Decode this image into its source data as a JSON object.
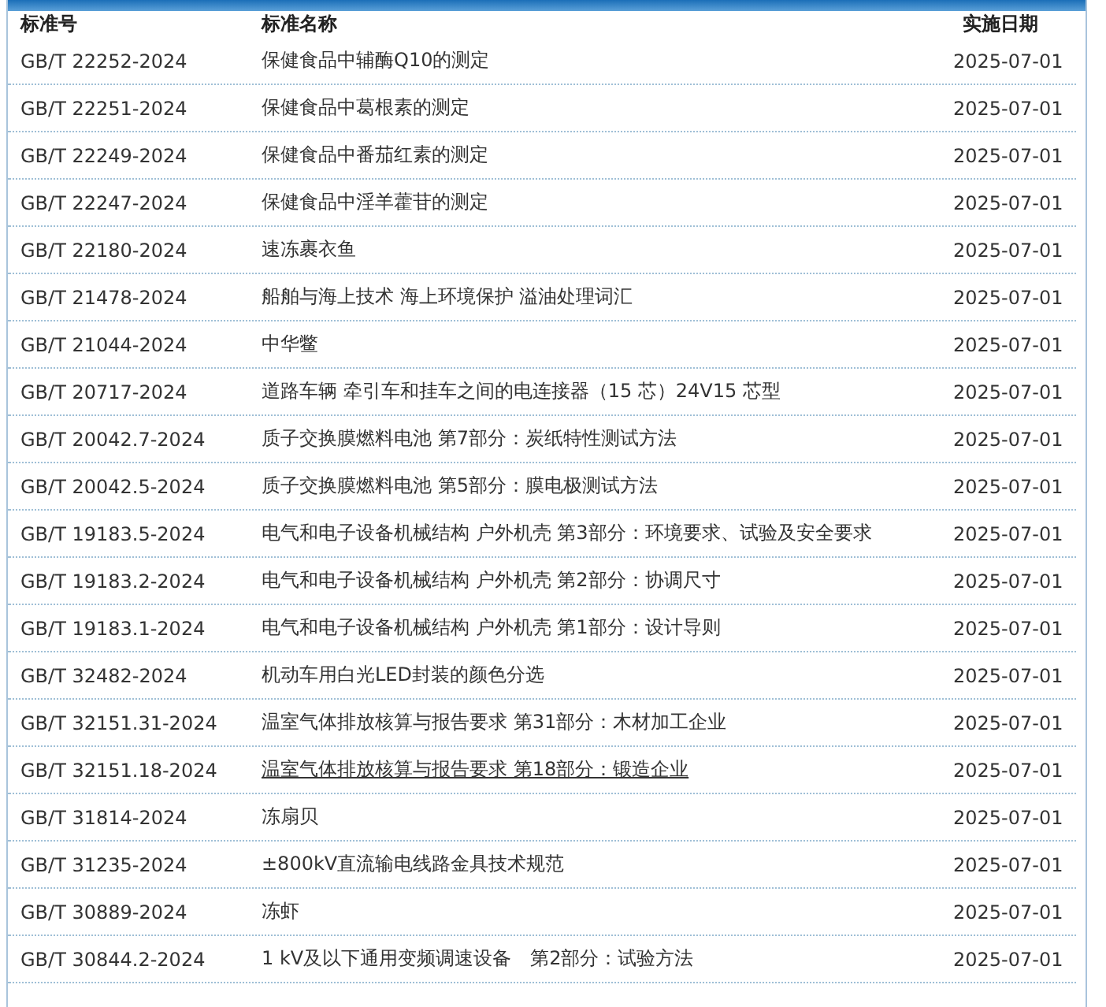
{
  "table": {
    "columns": [
      "标准号",
      "标准名称",
      "实施日期"
    ],
    "rows": [
      {
        "code": "GB/T 22252-2024",
        "name": "保健食品中辅酶Q10的测定",
        "date": "2025-07-01",
        "hovered": false
      },
      {
        "code": "GB/T 22251-2024",
        "name": "保健食品中葛根素的测定",
        "date": "2025-07-01",
        "hovered": false
      },
      {
        "code": "GB/T 22249-2024",
        "name": "保健食品中番茄红素的测定",
        "date": "2025-07-01",
        "hovered": false
      },
      {
        "code": "GB/T 22247-2024",
        "name": "保健食品中淫羊藿苷的测定",
        "date": "2025-07-01",
        "hovered": false
      },
      {
        "code": "GB/T 22180-2024",
        "name": "速冻裹衣鱼",
        "date": "2025-07-01",
        "hovered": false
      },
      {
        "code": "GB/T 21478-2024",
        "name": "船舶与海上技术 海上环境保护 溢油处理词汇",
        "date": "2025-07-01",
        "hovered": false
      },
      {
        "code": "GB/T 21044-2024",
        "name": "中华鳖",
        "date": "2025-07-01",
        "hovered": false
      },
      {
        "code": "GB/T 20717-2024",
        "name": "道路车辆 牵引车和挂车之间的电连接器（15 芯）24V15 芯型",
        "date": "2025-07-01",
        "hovered": false
      },
      {
        "code": "GB/T 20042.7-2024",
        "name": "质子交换膜燃料电池 第7部分：炭纸特性测试方法",
        "date": "2025-07-01",
        "hovered": false
      },
      {
        "code": "GB/T 20042.5-2024",
        "name": "质子交换膜燃料电池 第5部分：膜电极测试方法",
        "date": "2025-07-01",
        "hovered": false
      },
      {
        "code": "GB/T 19183.5-2024",
        "name": "电气和电子设备机械结构 户外机壳 第3部分：环境要求、试验及安全要求",
        "date": "2025-07-01",
        "hovered": false
      },
      {
        "code": "GB/T 19183.2-2024",
        "name": "电气和电子设备机械结构 户外机壳 第2部分：协调尺寸",
        "date": "2025-07-01",
        "hovered": false
      },
      {
        "code": "GB/T 19183.1-2024",
        "name": "电气和电子设备机械结构 户外机壳 第1部分：设计导则",
        "date": "2025-07-01",
        "hovered": false
      },
      {
        "code": "GB/T 32482-2024",
        "name": "机动车用白光LED封装的颜色分选",
        "date": "2025-07-01",
        "hovered": false
      },
      {
        "code": "GB/T 32151.31-2024",
        "name": "温室气体排放核算与报告要求 第31部分：木材加工企业",
        "date": "2025-07-01",
        "hovered": false
      },
      {
        "code": "GB/T 32151.18-2024",
        "name": "温室气体排放核算与报告要求 第18部分：锻造企业",
        "date": "2025-07-01",
        "hovered": true
      },
      {
        "code": "GB/T 31814-2024",
        "name": "冻扇贝",
        "date": "2025-07-01",
        "hovered": false
      },
      {
        "code": "GB/T 31235-2024",
        "name": "±800kV直流输电线路金具技术规范",
        "date": "2025-07-01",
        "hovered": false
      },
      {
        "code": "GB/T 30889-2024",
        "name": "冻虾",
        "date": "2025-07-01",
        "hovered": false
      },
      {
        "code": "GB/T 30844.2-2024",
        "name": "1 kV及以下通用变频调速设备　第2部分：试验方法",
        "date": "2025-07-01",
        "hovered": false
      }
    ]
  }
}
